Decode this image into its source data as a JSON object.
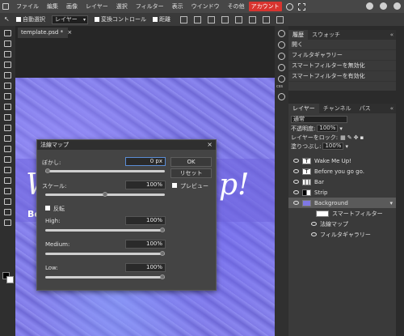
{
  "menubar": {
    "items": [
      "ファイル",
      "編集",
      "画像",
      "レイヤー",
      "選択",
      "フィルター",
      "表示",
      "ウインドウ",
      "その他"
    ],
    "account": "アカウント",
    "accent_color": "#d8342f"
  },
  "optionsbar": {
    "auto_select": "自動選択",
    "mode_value": "レイヤー",
    "transform": "変換コントロール",
    "distance": "距離"
  },
  "document": {
    "tab_label": "template.psd *"
  },
  "canvas": {
    "big_text_left": "W",
    "big_text_right": "p!",
    "sub_text": "Be"
  },
  "dialog": {
    "title": "法線マップ",
    "close": "×",
    "blur_label": "ぼかし:",
    "blur_value": "0 px",
    "ok": "OK",
    "reset": "リセット",
    "scale_label": "スケール:",
    "scale_value": "100%",
    "preview": "プレビュー",
    "invert": "反転",
    "high_label": "High:",
    "high_value": "100%",
    "medium_label": "Medium:",
    "medium_value": "100%",
    "low_label": "Low:",
    "low_value": "100%",
    "levels": {
      "blur": 0.0,
      "scale": 0.5,
      "high": 1.0,
      "medium": 1.0,
      "low": 1.0
    }
  },
  "rightstrip": {
    "css_label": "css"
  },
  "history": {
    "tabs": [
      "履歴",
      "スウォッチ"
    ],
    "items": [
      "開く",
      "フィルタギャラリー",
      "スマートフィルターを無効化",
      "スマートフィルターを有効化"
    ]
  },
  "layers": {
    "tabs": [
      "レイヤー",
      "チャンネル",
      "パス"
    ],
    "blend_mode": "通常",
    "opacity_label": "不透明度:",
    "opacity_value": "100%",
    "lock_label": "レイヤーをロック:",
    "fill_label": "塗りつぶし:",
    "fill_value": "100%",
    "items": [
      {
        "name": "Wake Me Up!",
        "kind": "text"
      },
      {
        "name": "Before you go go.",
        "kind": "text"
      },
      {
        "name": "Bar",
        "kind": "image"
      },
      {
        "name": "Strip",
        "kind": "image"
      },
      {
        "name": "Background",
        "kind": "smart",
        "selected": true
      }
    ],
    "smart_filters": "スマートフィルター",
    "filters": [
      "法線マップ",
      "フィルタギャラリー"
    ]
  }
}
